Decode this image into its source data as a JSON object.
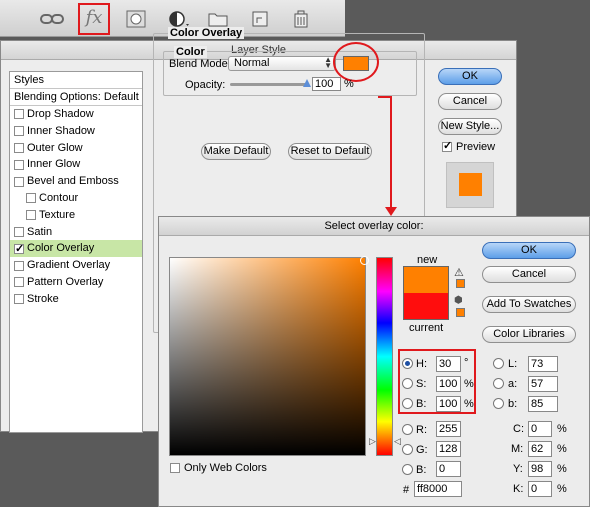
{
  "toolbar": {
    "icons": [
      "link-icon",
      "fx-icon",
      "mask-icon",
      "adjustment-icon",
      "folder-icon",
      "new-layer-icon",
      "trash-icon"
    ],
    "fx_label": "fx",
    "highlight_color": "#e0191d"
  },
  "layer_style": {
    "title": "Layer Style",
    "styles_header": "Styles",
    "blending_options": "Blending Options: Default",
    "items": [
      {
        "label": "Drop Shadow",
        "checked": false
      },
      {
        "label": "Inner Shadow",
        "checked": false
      },
      {
        "label": "Outer Glow",
        "checked": false
      },
      {
        "label": "Inner Glow",
        "checked": false
      },
      {
        "label": "Bevel and Emboss",
        "checked": false
      },
      {
        "label": "Contour",
        "checked": false
      },
      {
        "label": "Texture",
        "checked": false
      },
      {
        "label": "Satin",
        "checked": false
      },
      {
        "label": "Color Overlay",
        "checked": true
      },
      {
        "label": "Gradient Overlay",
        "checked": false
      },
      {
        "label": "Pattern Overlay",
        "checked": false
      },
      {
        "label": "Stroke",
        "checked": false
      }
    ],
    "group_title": "Color Overlay",
    "color_title": "Color",
    "blend_mode_label": "Blend Mode:",
    "blend_mode_value": "Normal",
    "overlay_color": "#ff8000",
    "opacity_label": "Opacity:",
    "opacity_value": "100",
    "opacity_unit": "%",
    "make_default": "Make Default",
    "reset_default": "Reset to Default",
    "ok": "OK",
    "cancel": "Cancel",
    "new_style": "New Style...",
    "preview_label": "Preview",
    "preview_checked": true
  },
  "picker": {
    "title": "Select overlay color:",
    "new_label": "new",
    "current_label": "current",
    "new_color": "#ff8000",
    "current_color": "#ff0d0d",
    "ok": "OK",
    "cancel": "Cancel",
    "add_swatches": "Add To Swatches",
    "color_libraries": "Color Libraries",
    "only_web": "Only Web Colors",
    "hsb": {
      "h_label": "H:",
      "h_value": "30",
      "h_unit": "°",
      "s_label": "S:",
      "s_value": "100",
      "s_unit": "%",
      "b_label": "B:",
      "b_value": "100",
      "b_unit": "%"
    },
    "rgb": {
      "r_label": "R:",
      "r_value": "255",
      "g_label": "G:",
      "g_value": "128",
      "b_label": "B:",
      "b_value": "0"
    },
    "lab": {
      "l_label": "L:",
      "l_value": "73",
      "a_label": "a:",
      "a_value": "57",
      "b_label": "b:",
      "b_value": "85"
    },
    "cmyk": {
      "c_label": "C:",
      "c_value": "0",
      "m_label": "M:",
      "m_value": "62",
      "y_label": "Y:",
      "y_value": "98",
      "k_label": "K:",
      "k_value": "0",
      "unit": "%"
    },
    "hex_label": "#",
    "hex_value": "ff8000"
  }
}
